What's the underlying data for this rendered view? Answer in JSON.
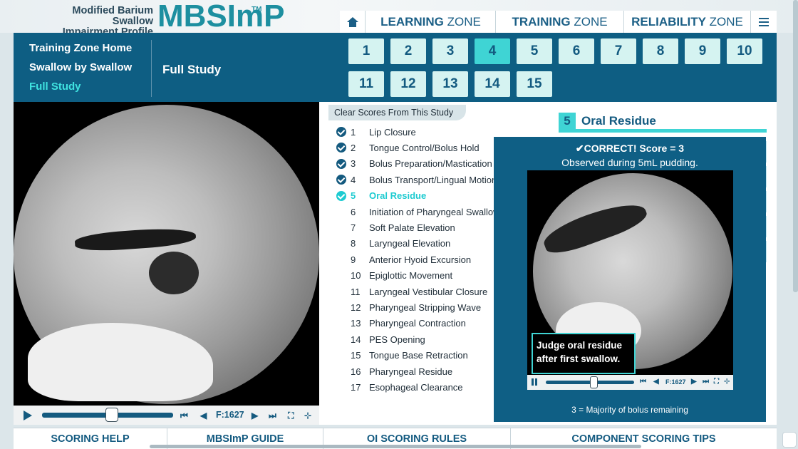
{
  "brand": {
    "line1": "Modified Barium Swallow",
    "line2": "Impairment Profile",
    "logo": "MBSImP",
    "tm": "TM"
  },
  "topnav": {
    "home_icon": "home-icon",
    "learning": {
      "bold": "LEARNING",
      "rest": " ZONE"
    },
    "training": {
      "bold": "TRAINING",
      "rest": " ZONE"
    },
    "reliability": {
      "bold": "RELIABILITY",
      "rest": " ZONE"
    },
    "menu_icon": "hamburger-icon"
  },
  "subnav": {
    "items": [
      {
        "label": "Training Zone Home"
      },
      {
        "label": "Swallow by Swallow"
      },
      {
        "label": "Full Study"
      }
    ],
    "active_index": 2,
    "title": "Full Study"
  },
  "swallow_buttons": {
    "labels": [
      "1",
      "2",
      "3",
      "4",
      "5",
      "6",
      "7",
      "8",
      "9",
      "10",
      "11",
      "12",
      "13",
      "14",
      "15"
    ],
    "selected": "4"
  },
  "video": {
    "frame": "F:1627"
  },
  "criteria": {
    "clear_label": "Clear Scores From This Study",
    "items": [
      {
        "num": "1",
        "label": "Lip Closure",
        "checked": true
      },
      {
        "num": "2",
        "label": "Tongue Control/Bolus Hold",
        "checked": true
      },
      {
        "num": "3",
        "label": "Bolus Preparation/Mastication",
        "checked": true
      },
      {
        "num": "4",
        "label": "Bolus Transport/Lingual Motion",
        "checked": true
      },
      {
        "num": "5",
        "label": "Oral Residue",
        "checked": true,
        "active": true
      },
      {
        "num": "6",
        "label": "Initiation of Pharyngeal Swallow",
        "checked": false
      },
      {
        "num": "7",
        "label": "Soft Palate Elevation",
        "checked": false
      },
      {
        "num": "8",
        "label": "Laryngeal Elevation",
        "checked": false
      },
      {
        "num": "9",
        "label": "Anterior Hyoid Excursion",
        "checked": false
      },
      {
        "num": "10",
        "label": "Epiglottic Movement",
        "checked": false
      },
      {
        "num": "11",
        "label": "Laryngeal Vestibular Closure",
        "checked": false
      },
      {
        "num": "12",
        "label": "Pharyngeal Stripping Wave",
        "checked": false
      },
      {
        "num": "13",
        "label": "Pharyngeal Contraction",
        "checked": false
      },
      {
        "num": "14",
        "label": "PES Opening",
        "checked": false
      },
      {
        "num": "15",
        "label": "Tongue Base Retraction",
        "checked": false
      },
      {
        "num": "16",
        "label": "Pharyngeal Residue",
        "checked": false
      },
      {
        "num": "17",
        "label": "Esophageal Clearance",
        "checked": false
      }
    ]
  },
  "component": {
    "num": "5",
    "title": "Oral Residue"
  },
  "popup": {
    "correct": "✔CORRECT!   Score = 3",
    "observed": "Observed during 5mL pudding.",
    "caption_line1": "Judge oral residue",
    "caption_line2": "after first swallow.",
    "frame": "F:1627",
    "footer": "3 = Majority of bolus remaining"
  },
  "bottom_tabs": [
    {
      "label": "SCORING HELP"
    },
    {
      "label": "MBSImP GUIDE"
    },
    {
      "label": "OI SCORING RULES"
    },
    {
      "label": "COMPONENT SCORING TIPS"
    }
  ],
  "colors": {
    "brand_blue": "#0e5e83",
    "accent_teal": "#3fd4d4",
    "active_text": "#1ecbd1"
  }
}
